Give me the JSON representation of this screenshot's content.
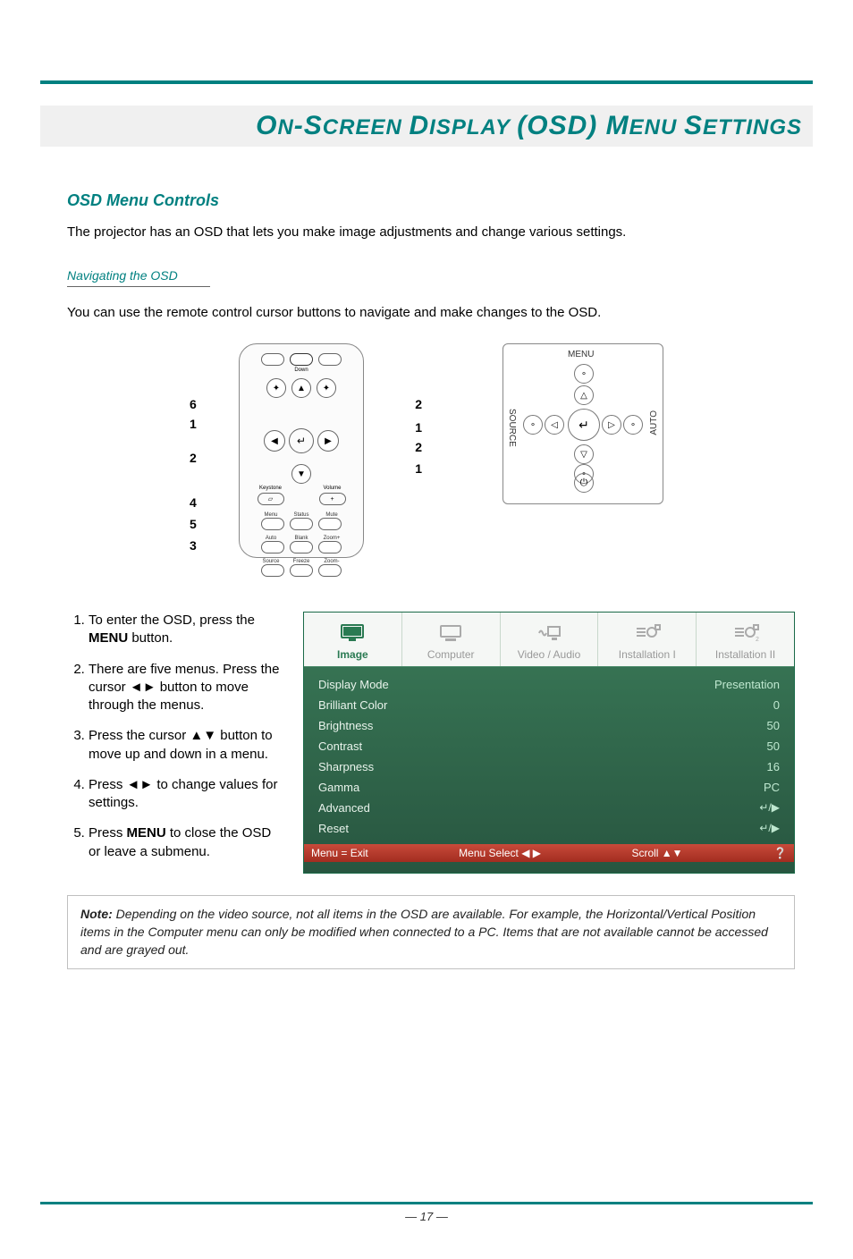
{
  "title": {
    "prefix": "O",
    "p1": "N",
    "dash": "-",
    "s": "S",
    "p2": "CREEN ",
    "d": "D",
    "p3": "ISPLAY ",
    "paren": "(OSD) ",
    "m": "M",
    "p4": "ENU ",
    "ss": "S",
    "p5": "ETTINGS"
  },
  "section1_head": "OSD Menu Controls",
  "intro": "The projector has an OSD that lets you make image adjustments and change various settings.",
  "subhead": "Navigating the OSD",
  "nav_intro": "You can use the remote control cursor buttons to navigate and make changes to the OSD.",
  "remote_callouts": {
    "r2a": "2",
    "r1a": "1",
    "r2b": "2",
    "r1b": "1",
    "l6": "6",
    "l1": "1",
    "l2": "2",
    "l4": "4",
    "l5": "5",
    "l3": "3"
  },
  "remote_labels": {
    "down": "Down",
    "keystone": "Keystone",
    "volume": "Volume",
    "menu": "Menu",
    "status": "Status",
    "mute": "Mute",
    "auto": "Auto",
    "blank": "Blank",
    "zoomp": "Zoom+",
    "source": "Source",
    "freeze": "Freeze",
    "zoomm": "Zoom-"
  },
  "panel_labels": {
    "menu": "MENU",
    "source": "SOURCE",
    "auto": "AUTO"
  },
  "steps": [
    {
      "pre": "To enter the OSD, press the ",
      "kw": "MENU",
      "post": " button."
    },
    {
      "pre": "There are five menus. Press the cursor ◄► button to move through the menus.",
      "kw": "",
      "post": ""
    },
    {
      "pre": "Press the cursor ▲▼ button to move up and down in a menu.",
      "kw": "",
      "post": ""
    },
    {
      "pre": "Press ◄► to change values for settings.",
      "kw": "",
      "post": ""
    },
    {
      "pre": "Press ",
      "kw": "MENU",
      "post": " to close the OSD or leave a submenu."
    }
  ],
  "osd": {
    "tabs": [
      "Image",
      "Computer",
      "Video / Audio",
      "Installation I",
      "Installation II"
    ],
    "rows": [
      {
        "label": "Display Mode",
        "value": "Presentation"
      },
      {
        "label": "Brilliant Color",
        "value": "0"
      },
      {
        "label": "Brightness",
        "value": "50"
      },
      {
        "label": "Contrast",
        "value": "50"
      },
      {
        "label": "Sharpness",
        "value": "16"
      },
      {
        "label": "Gamma",
        "value": "PC"
      },
      {
        "label": "Advanced",
        "value": "↵/▶"
      },
      {
        "label": "Reset",
        "value": "↵/▶"
      }
    ],
    "footer": {
      "exit": "Menu = Exit",
      "select": "Menu Select ◀ ▶",
      "scroll": "Scroll ▲▼"
    }
  },
  "note": {
    "label": "Note:",
    "text": " Depending on the video source, not all items in the OSD are available. For example, the Horizontal/Vertical Position items in the Computer menu can only be modified when connected to a PC. Items that are not available cannot be accessed and are grayed out."
  },
  "page_number": "— 17 —"
}
